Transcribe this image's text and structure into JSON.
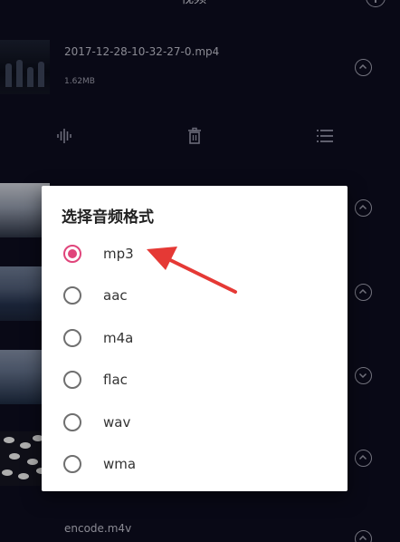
{
  "header": {
    "title": "视频"
  },
  "items": [
    {
      "name": "2017-12-28-10-32-27-0.mp4",
      "size": "1.62MB"
    },
    {
      "name": "encode.m4v"
    }
  ],
  "dialog": {
    "title": "选择音频格式",
    "options": [
      {
        "label": "mp3",
        "selected": true
      },
      {
        "label": "aac",
        "selected": false
      },
      {
        "label": "m4a",
        "selected": false
      },
      {
        "label": "flac",
        "selected": false
      },
      {
        "label": "wav",
        "selected": false
      },
      {
        "label": "wma",
        "selected": false
      }
    ]
  },
  "colors": {
    "accent": "#e0457b",
    "arrow": "#e53935",
    "background": "#0c0c1e"
  },
  "icons": [
    "add-circle-icon",
    "audio-waveform-icon",
    "trash-icon",
    "list-icon",
    "chevron-up-icon",
    "chevron-down-icon"
  ]
}
